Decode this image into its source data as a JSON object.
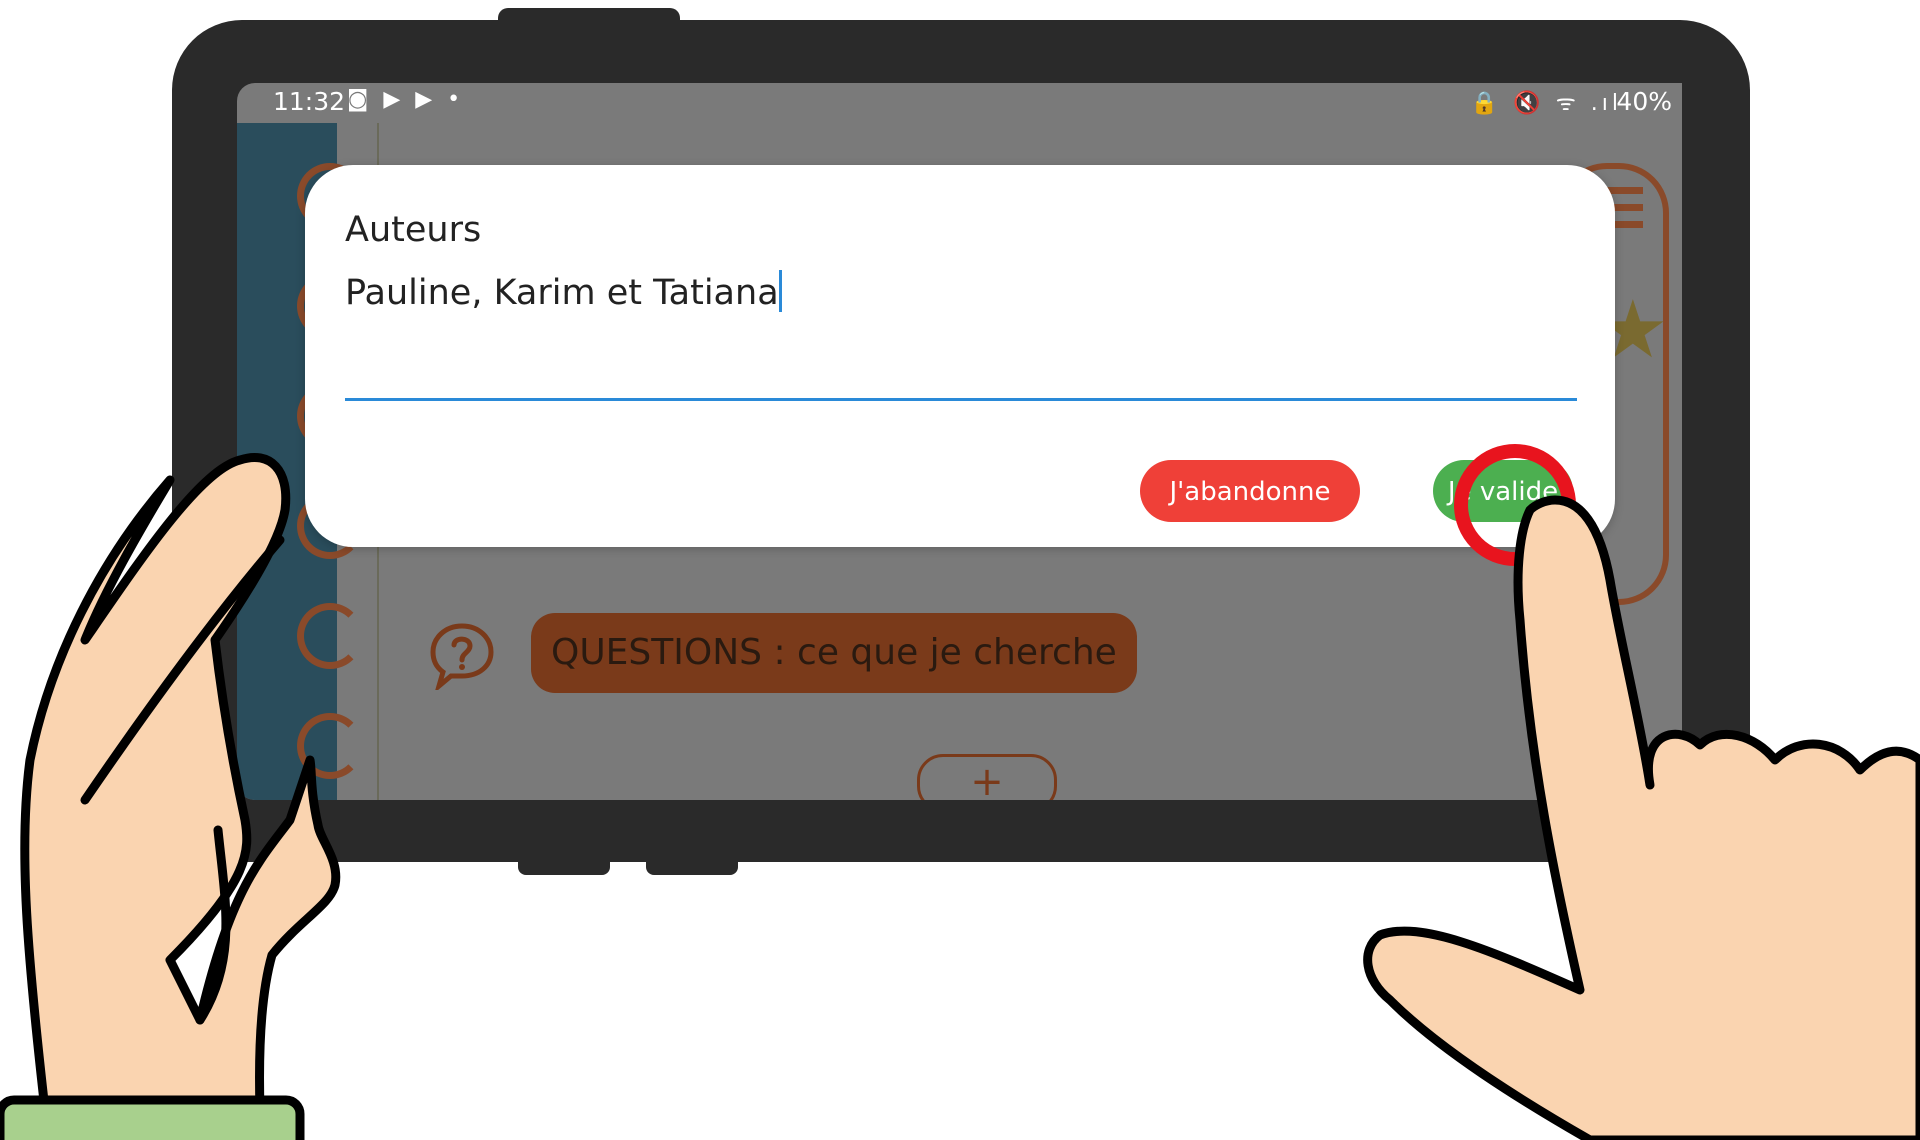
{
  "status_bar": {
    "time": "11:32",
    "notification_icons": "◙ ▶ ▶ •",
    "system_icons": "🔒 🔇 ᯤ .ıl",
    "battery": "40%"
  },
  "app": {
    "questions_label": "QUESTIONS : ce que je cherche",
    "add_label": "+"
  },
  "dialog": {
    "title": "Auteurs",
    "input_value": "Pauline, Karim et Tatiana",
    "cancel_label": "J'abandonne",
    "confirm_label": "Je valide"
  },
  "colors": {
    "device_frame": "#2a2a2a",
    "skin": "#fad4b0",
    "sleeve": "#a8d08d",
    "highlight_ring": "#e8141e",
    "cancel_button": "#ef4038",
    "confirm_button": "#4caf50",
    "input_underline": "#2a8ad8"
  }
}
